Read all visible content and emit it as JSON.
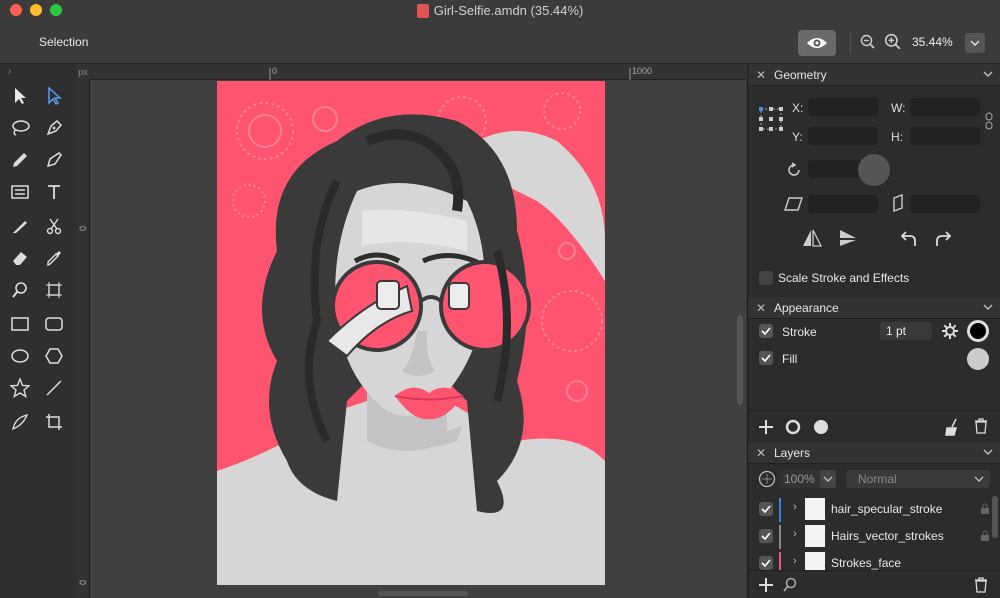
{
  "window": {
    "title": "Girl-Selfie.amdn (35.44%)"
  },
  "toolbar": {
    "current_tool": "Selection",
    "zoom": "35.44%"
  },
  "rulers": {
    "unit": "px",
    "h_labels": [
      "0",
      "1000"
    ],
    "v_labels": [
      "0",
      "0"
    ]
  },
  "geometry": {
    "title": "Geometry",
    "x_label": "X:",
    "y_label": "Y:",
    "w_label": "W:",
    "h_label": "H:",
    "scale_label": "Scale Stroke and Effects"
  },
  "appearance": {
    "title": "Appearance",
    "stroke_label": "Stroke",
    "stroke_width": "1 pt",
    "fill_label": "Fill",
    "stroke_color": "#000000",
    "fill_color": "#cccccc"
  },
  "layers": {
    "title": "Layers",
    "opacity": "100%",
    "blend_mode": "Normal",
    "items": [
      {
        "name": "hair_specular_stroke",
        "color": "#3d7fe0"
      },
      {
        "name": "Hairs_vector_strokes",
        "color": "#888888"
      },
      {
        "name": "Strokes_face",
        "color": "#e05a8a"
      }
    ]
  },
  "colors": {
    "accent_pink": "#ff5470",
    "artboard_bg": "#ff5470"
  }
}
